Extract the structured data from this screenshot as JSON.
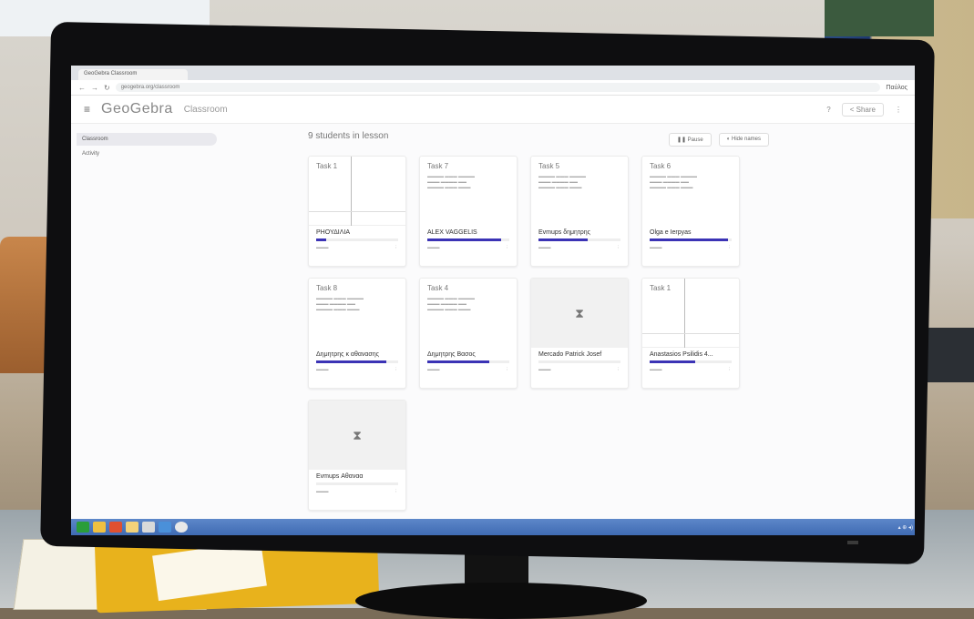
{
  "browser": {
    "tab_title": "GeoGebra Classroom",
    "url": "geogebra.org/classroom",
    "profile_label": "Παύλος"
  },
  "app": {
    "logo": "GeoGebra",
    "section": "Classroom",
    "share_label": "Share"
  },
  "sidebar": {
    "items": [
      {
        "label": "Classroom",
        "active": true
      },
      {
        "label": "Activity"
      }
    ]
  },
  "main": {
    "title": "9 students in lesson",
    "toolbar": {
      "pause_label": "Pause",
      "hide_names_label": "Hide names"
    }
  },
  "students": [
    {
      "task": "Task 1",
      "name": "ΡΗΟΥΔΙΛΙΑ",
      "progress": 0.12,
      "preview": "graph"
    },
    {
      "task": "Task 7",
      "name": "ALEX VAGGELIS",
      "progress": 0.9,
      "preview": "text"
    },
    {
      "task": "Task 5",
      "name": "Evmups δημητρης",
      "progress": 0.6,
      "preview": "text"
    },
    {
      "task": "Task 6",
      "name": "Olga e Ierpyas",
      "progress": 0.95,
      "preview": "text"
    },
    {
      "task": "Task 8",
      "name": "Δημητρης κ αθανασης",
      "progress": 0.85,
      "preview": "text"
    },
    {
      "task": "Task 4",
      "name": "Δημητρης Βασος",
      "progress": 0.75,
      "preview": "text"
    },
    {
      "task": "",
      "name": "Mercado Patrick Josef",
      "progress": 0.0,
      "preview": "empty"
    },
    {
      "task": "Task 1",
      "name": "Anastasios Psilidis 4...",
      "progress": 0.55,
      "preview": "graph"
    },
    {
      "task": "",
      "name": "Evmups Αθαναα",
      "progress": 0.0,
      "preview": "empty"
    }
  ],
  "monitor": {
    "brand": "LG"
  }
}
